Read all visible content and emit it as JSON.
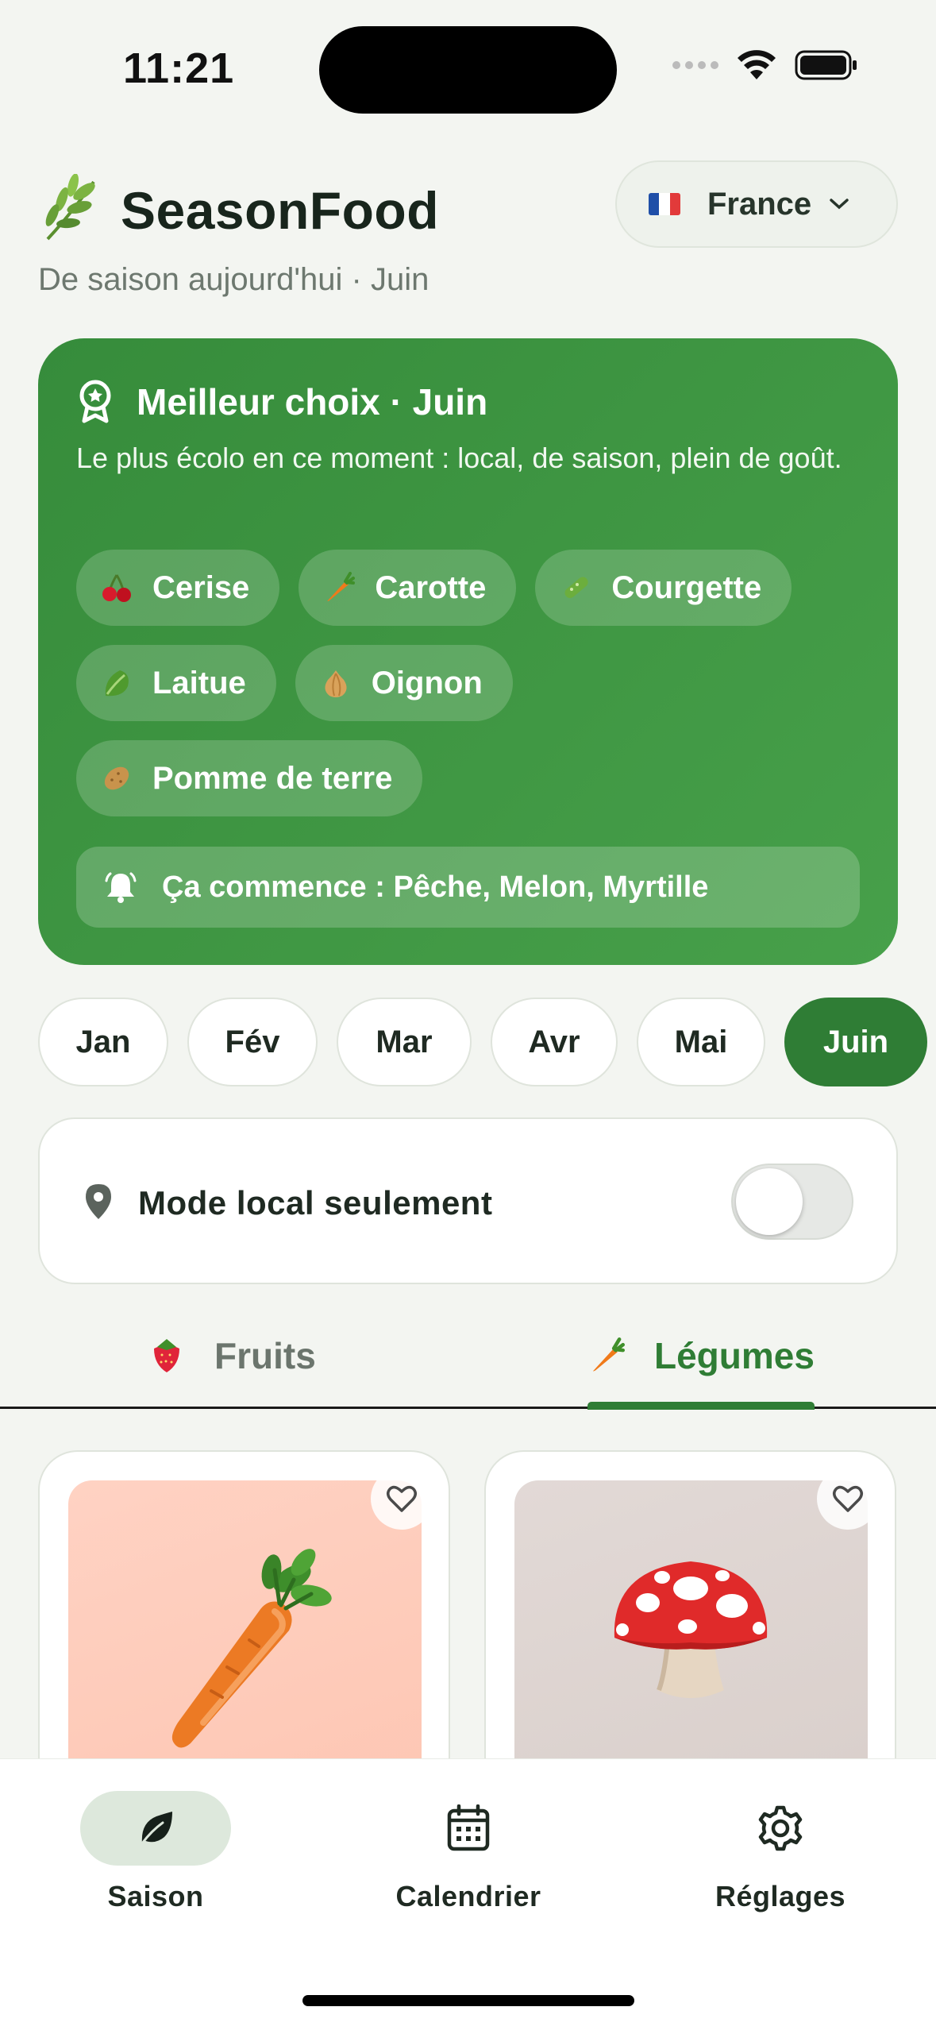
{
  "status": {
    "time": "11:21"
  },
  "header": {
    "title": "SeasonFood",
    "logo_icon": "leaf-sprig-icon",
    "country": "France",
    "subtitle": "De saison aujourd'hui · Juin"
  },
  "best": {
    "title": "Meilleur choix · Juin",
    "description": "Le plus écolo en ce moment : local, de saison, plein de goût.",
    "chips": [
      {
        "label": "Cerise",
        "icon": "cherry-icon"
      },
      {
        "label": "Carotte",
        "icon": "carrot-icon"
      },
      {
        "label": "Courgette",
        "icon": "cucumber-icon"
      },
      {
        "label": "Laitue",
        "icon": "lettuce-icon"
      },
      {
        "label": "Oignon",
        "icon": "onion-icon"
      },
      {
        "label": "Pomme de terre",
        "icon": "potato-icon"
      }
    ],
    "starts_text": "Ça commence : Pêche, Melon, Myrtille"
  },
  "months": [
    "Jan",
    "Fév",
    "Mar",
    "Avr",
    "Mai",
    "Juin"
  ],
  "active_month": "Juin",
  "local_mode": {
    "label": "Mode local seulement",
    "enabled": false
  },
  "tabs": [
    {
      "label": "Fruits",
      "icon": "strawberry-icon",
      "active": false
    },
    {
      "label": "Légumes",
      "icon": "carrot-icon",
      "active": true
    }
  ],
  "products": [
    {
      "icon": "carrot-icon",
      "color": "#fdc6b3"
    },
    {
      "icon": "mushroom-icon",
      "color": "#d9cfcb"
    }
  ],
  "nav": [
    {
      "label": "Saison",
      "icon": "leaf-icon",
      "active": true
    },
    {
      "label": "Calendrier",
      "icon": "calendar-icon",
      "active": false
    },
    {
      "label": "Réglages",
      "icon": "gear-icon",
      "active": false
    }
  ],
  "colors": {
    "accent": "#2f7d35",
    "card_green": "#3f9642",
    "background": "#f3f5f1"
  }
}
